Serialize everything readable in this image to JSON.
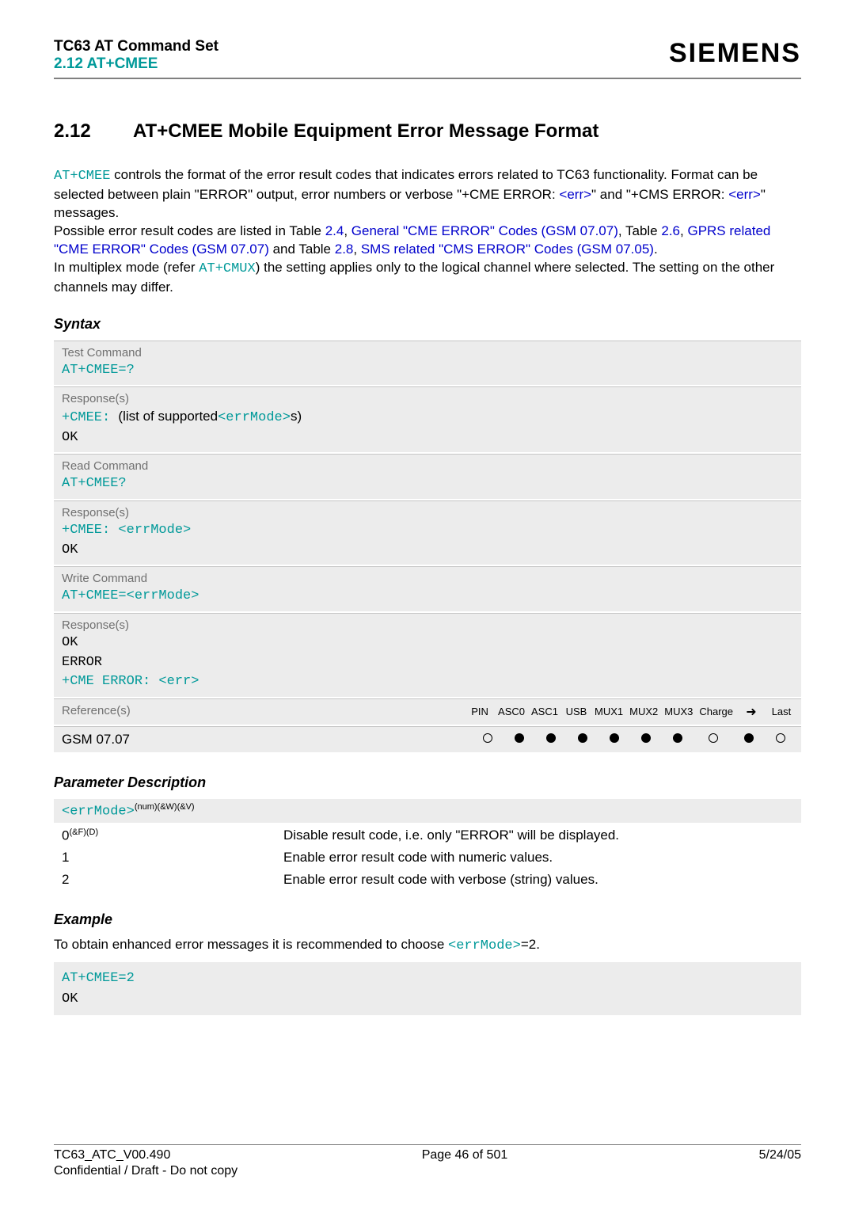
{
  "header": {
    "title": "TC63 AT Command Set",
    "subtitle": "2.12 AT+CMEE",
    "brand": "SIEMENS"
  },
  "section": {
    "num": "2.12",
    "title": "AT+CMEE   Mobile Equipment Error Message Format"
  },
  "intro": {
    "cmd": "AT+CMEE",
    "t1": " controls the format of the error result codes that indicates errors related to TC63 functionality. Format can be selected between plain \"ERROR\" output, error numbers or verbose \"+CME ERROR: ",
    "err1": "<err>",
    "t2": "\" and \"+CMS ERROR: ",
    "err2": "<err>",
    "t3": "\" messages.",
    "p2a": "Possible error result codes are listed in Table ",
    "l1": "2.4",
    "c1": ", ",
    "l2": "General \"CME ERROR\" Codes (GSM 07.07)",
    "c2": ", Table ",
    "l3": "2.6",
    "c3": ", ",
    "l4": "GPRS related \"CME ERROR\" Codes (GSM 07.07)",
    "c4": " and Table ",
    "l5": "2.8",
    "c5": ", ",
    "l6": "SMS related \"CMS ERROR\" Codes (GSM 07.05)",
    "c6": ".",
    "p3a": "In multiplex mode (refer ",
    "mux": "AT+CMUX",
    "p3b": ") the setting applies only to the logical channel where selected. The setting on the other channels may differ."
  },
  "syntax": {
    "heading": "Syntax",
    "test_label": "Test Command",
    "test_cmd": "AT+CMEE=?",
    "resp_label": "Response(s)",
    "test_resp_pre": "+CMEE: ",
    "test_resp_mid": "(list of supported",
    "errmode": "<errMode>",
    "test_resp_post": "s)",
    "ok": "OK",
    "read_label": "Read Command",
    "read_cmd": "AT+CMEE?",
    "read_resp": "+CMEE: ",
    "write_label": "Write Command",
    "write_cmd_pre": "AT+CMEE=",
    "error": "ERROR",
    "cme_err_pre": "+CME ERROR: ",
    "cme_err": "<err>",
    "ref_label": "Reference(s)",
    "ref_val": "GSM 07.07",
    "cols": [
      "PIN",
      "ASC0",
      "ASC1",
      "USB",
      "MUX1",
      "MUX2",
      "MUX3",
      "Charge",
      "➜",
      "Last"
    ],
    "dots": [
      "empty",
      "filled",
      "filled",
      "filled",
      "filled",
      "filled",
      "filled",
      "empty",
      "filled",
      "empty"
    ]
  },
  "params": {
    "heading": "Parameter Description",
    "band_var": "<errMode>",
    "band_sup": "(num)(&W)(&V)",
    "rows": [
      {
        "k": "0",
        "ksup": "(&F)(D)",
        "v": "Disable result code, i.e. only \"ERROR\" will be displayed."
      },
      {
        "k": "1",
        "ksup": "",
        "v": "Enable error result code with numeric values."
      },
      {
        "k": "2",
        "ksup": "",
        "v": "Enable error result code with verbose (string) values."
      }
    ]
  },
  "example": {
    "heading": "Example",
    "text_a": "To obtain enhanced error messages it is recommended to choose ",
    "var": "<errMode>",
    "text_b": "=2.",
    "line1": "AT+CMEE=2",
    "line2": "OK"
  },
  "footer": {
    "left": "TC63_ATC_V00.490",
    "center": "Page 46 of 501",
    "right": "5/24/05",
    "left2": "Confidential / Draft - Do not copy"
  }
}
